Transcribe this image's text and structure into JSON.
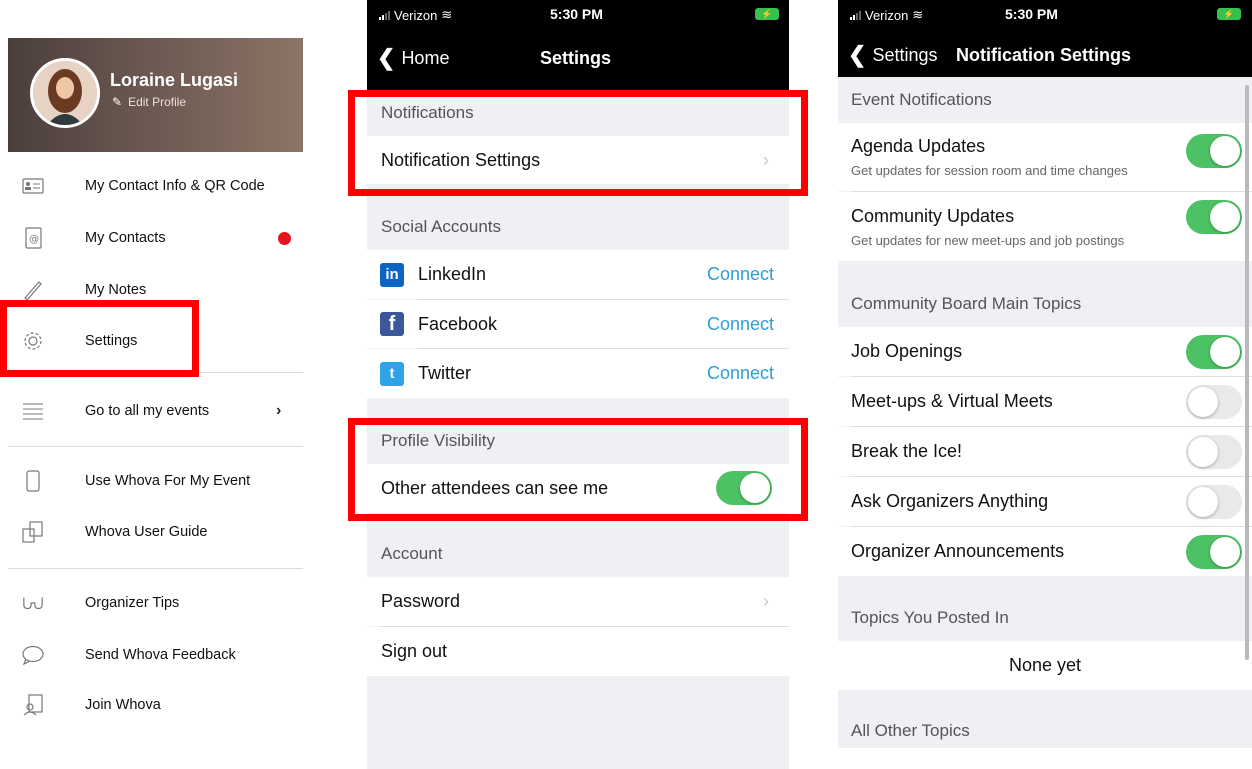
{
  "menu": {
    "profile_name": "Loraine Lugasi",
    "edit_profile": "Edit Profile",
    "items": [
      {
        "label": "My Contact Info & QR Code",
        "icon": "contact-card-icon"
      },
      {
        "label": "My Contacts",
        "icon": "address-book-icon"
      },
      {
        "label": "My Notes",
        "icon": "pen-icon"
      },
      {
        "label": "Settings",
        "icon": "gear-icon"
      },
      {
        "label": "Go to all my events",
        "icon": "list-icon"
      },
      {
        "label": "Use Whova For My Event",
        "icon": "phone-icon"
      },
      {
        "label": "Whova User Guide",
        "icon": "guide-icon"
      },
      {
        "label": "Organizer Tips",
        "icon": "glasses-icon"
      },
      {
        "label": "Send Whova Feedback",
        "icon": "speech-bubble-icon"
      },
      {
        "label": "Join Whova",
        "icon": "person-document-icon"
      }
    ]
  },
  "settings_screen": {
    "status": {
      "carrier": "Verizon",
      "time": "5:30 PM"
    },
    "back_label": "Home",
    "title": "Settings",
    "sections": {
      "notifications": "Notifications",
      "notification_settings": "Notification Settings",
      "social_accounts": "Social Accounts",
      "profile_visibility": "Profile Visibility",
      "visibility_toggle_label": "Other attendees can see me",
      "account": "Account",
      "password": "Password",
      "sign_out": "Sign out"
    },
    "social": [
      {
        "name": "LinkedIn",
        "action": "Connect",
        "logo": "in",
        "color": "#0a66c2"
      },
      {
        "name": "Facebook",
        "action": "Connect",
        "logo": "f",
        "color": "#3b5998"
      },
      {
        "name": "Twitter",
        "action": "Connect",
        "logo": "t",
        "color": "#2ea4e8"
      }
    ],
    "visibility_on": true
  },
  "notification_screen": {
    "status": {
      "carrier": "Verizon",
      "time": "5:30 PM"
    },
    "back_label": "Settings",
    "title": "Notification Settings",
    "event_header": "Event Notifications",
    "agenda_title": "Agenda Updates",
    "agenda_sub": "Get updates for session room and time changes",
    "community_title": "Community Updates",
    "community_sub": "Get updates for new meet-ups and job postings",
    "board_header": "Community Board Main Topics",
    "topics": [
      {
        "label": "Job Openings",
        "on": true
      },
      {
        "label": "Meet-ups & Virtual Meets",
        "on": false
      },
      {
        "label": "Break the Ice!",
        "on": false
      },
      {
        "label": "Ask Organizers Anything",
        "on": false
      },
      {
        "label": "Organizer Announcements",
        "on": true
      }
    ],
    "posted_header": "Topics You Posted In",
    "none_yet": "None yet",
    "other_header": "All Other Topics"
  },
  "colors": {
    "highlight": "#ff0000",
    "toggle_on": "#4cc264",
    "link": "#2c9fd6",
    "notification_dot": "#e8141c"
  }
}
